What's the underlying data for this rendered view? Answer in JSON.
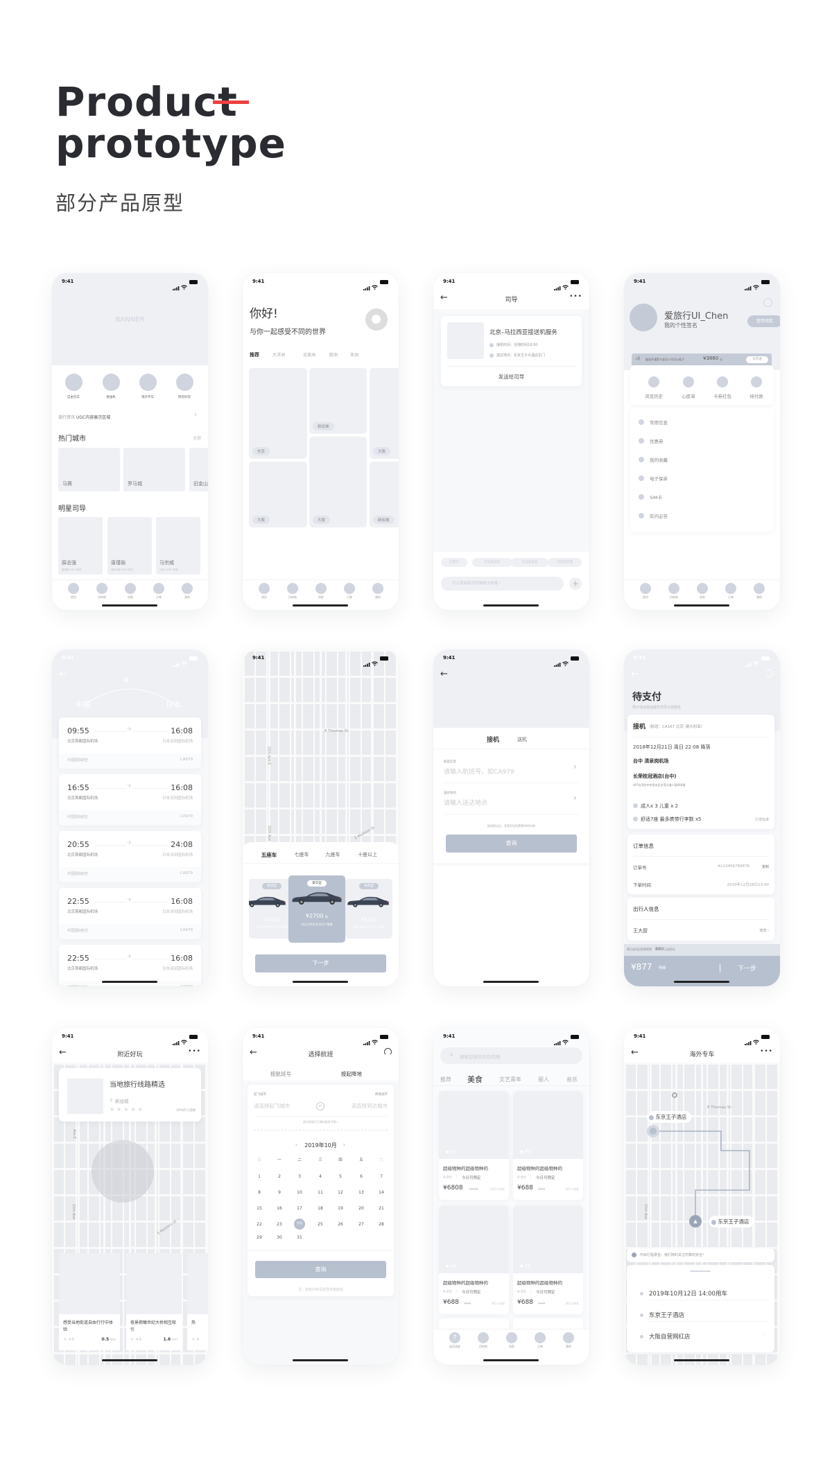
{
  "header": {
    "title_line1": "Product",
    "title_line2": "prototype",
    "subtitle": "部分产品原型",
    "accent_color": "#ee4040"
  },
  "colors": {
    "placeholder": "#eef0f4",
    "accent": "#b7c0cf",
    "dot": "#cfd4de"
  },
  "status_time": "9:41",
  "tabbar": [
    "首页",
    "目的地",
    "消息",
    "订单",
    "我的"
  ],
  "screens": {
    "home": {
      "banner": "BANNER",
      "shortcuts": [
        "自由包车",
        "接送机",
        "境外专车",
        "附近好玩"
      ],
      "news_label": "旅行资讯",
      "news_text": "UGC内容展示区域",
      "hot_title": "热门城市",
      "hot_more": "全部",
      "cities": [
        "马赛",
        "罗马城",
        "旧金山"
      ],
      "guides_title": "明星司导",
      "guides": [
        {
          "name": "薛志强",
          "meta": "新加坡·100+好评"
        },
        {
          "name": "唐瑾瑜",
          "meta": "澳大利亚·900+好评"
        },
        {
          "name": "马宗威",
          "meta": "日本·1200+好评"
        }
      ]
    },
    "discover": {
      "greeting": "你好!",
      "slogan": "与你一起感受不同的世界",
      "tabs": [
        "推荐",
        "大洋洲",
        "北美洲",
        "欧洲",
        "亚洲"
      ],
      "tiles": [
        "东京",
        "新加坡",
        "大阪",
        "大阪",
        "大阪",
        "新加坡"
      ]
    },
    "chat": {
      "title": "司导",
      "card_title": "北京–马拉西亚接送机服务",
      "lines": [
        "接机时间：当地时间18:00",
        "送达地点：东京王子大酒店东门"
      ],
      "send": "发送给司导",
      "chips": [
        "问景点",
        "问当地美食",
        "问当地美食",
        "问当地交通"
      ],
      "input_placeholder": "可以提前和司导聊聊当地哦~"
    },
    "profile": {
      "name": "爱旅行UI_Chen",
      "signature": "我的个性签名",
      "checkin": "签到领奖",
      "promo_text": "据说开通黑卡会员人均可以省下",
      "promo_amount": "¥3860",
      "promo_unit": "元",
      "promo_btn": "去开通",
      "quick": [
        "浏览历史",
        "心愿单",
        "卡券红包",
        "待付款"
      ],
      "menu": [
        "常用信息",
        "优惠券",
        "我的收藏",
        "电子保单",
        "SIM卡",
        "有问必答"
      ]
    },
    "flights": {
      "from": "中国",
      "to": "日本",
      "list": [
        {
          "dep": "09:55",
          "arr": "16:08",
          "from_airport": "北京首都国际机场",
          "to_airport": "日本羽田国际机场",
          "airline": "中国国际航空",
          "code": "CA979"
        },
        {
          "dep": "16:55",
          "arr": "16:08",
          "from_airport": "北京首都国际机场",
          "to_airport": "日本羽田国际机场",
          "airline": "中国国际航空",
          "code": "CA979"
        },
        {
          "dep": "20:55",
          "arr": "24:08",
          "from_airport": "北京首都国际机场",
          "to_airport": "日本羽田国际机场",
          "airline": "中国国际航空",
          "code": "CA979"
        },
        {
          "dep": "22:55",
          "arr": "16:08",
          "from_airport": "北京首都国际机场",
          "to_airport": "日本羽田国际机场",
          "airline": "中国国际航空",
          "code": "CA979"
        },
        {
          "dep": "22:55",
          "arr": "16:08",
          "from_airport": "北京首都国际机场",
          "to_airport": "日本羽田国际机场",
          "airline": "中国国际航空",
          "code": "CA979"
        }
      ]
    },
    "car": {
      "streets": [
        "E Thomas St",
        "15th Ave E",
        "15th Ave",
        "E Madison St"
      ],
      "seat_tabs": [
        "五座车",
        "七座车",
        "九座车",
        "十座以上"
      ],
      "cars": [
        {
          "badge": "舒适型",
          "price": "¥1800",
          "suffix": "",
          "desc": "丰田卡罗拉/东风日产骐威"
        },
        {
          "badge": "豪华型",
          "price": "¥2700",
          "suffix": "起",
          "desc": "丰田卡罗拉/东风日产骐威"
        },
        {
          "badge": "商务型",
          "price": "¥3200",
          "suffix": "",
          "desc": "丰田卡罗拉/东风日产骐威"
        }
      ],
      "next": "下一步"
    },
    "pickup": {
      "tabs": [
        "接机",
        "送机"
      ],
      "fields": [
        {
          "label": "航班信息",
          "placeholder": "请输入航班号，如CA979"
        },
        {
          "label": "送达地点",
          "placeholder": "请输入送达地点"
        }
      ],
      "note": "航班到达后，享受司导免费等待90分钟",
      "submit": "查询"
    },
    "order": {
      "title": "待支付",
      "subtitle": "预计待会挑选最优司导为您服务",
      "service": "接机",
      "flight": "（航班：CA167 北京–澳大利亚）",
      "datetime": "2018年12月21日 周日 22:08 降落",
      "airport": "台中 清泉岗机场",
      "hotel": "长荣桂冠酒店(台中)",
      "address": "407台湾台中市西屯区台湾大道二段666號",
      "passengers": "成人x 3  儿童 x 2",
      "vehicle": "舒适7座  最多携带行李数 x5",
      "luggage": "行李标准",
      "order_info": "订单信息",
      "order_no_label": "订单号",
      "order_no": "A123456789876",
      "copy": "复制",
      "time_label": "下单时间",
      "time": "2019年12月28日13:40",
      "traveler_title": "出行人信息",
      "traveler": "王大厨",
      "edit": "修改 ›",
      "points_pre": "预订成功后您将获得",
      "points": "880",
      "points_post": "元宝积分",
      "price": "¥877",
      "detail": "明细",
      "next": "下一步"
    },
    "nearby": {
      "title": "附近好玩",
      "featured_title": "当地旅行线路精选",
      "location": "新加坡",
      "percent": "30%的人选择",
      "streets": [
        "Ave E",
        "15th Ave",
        "E Madison St"
      ],
      "cards": [
        {
          "title": "感受当地街道自由行行中体验",
          "rating": "4.5",
          "dist": "0.5",
          "unit": "km"
        },
        {
          "title": "夜景俯瞰世纪大桥相互吸引",
          "rating": "4.5",
          "dist": "1.6",
          "unit": "km"
        },
        {
          "title": "热",
          "rating": "4",
          "dist": "",
          "unit": ""
        }
      ]
    },
    "flight_select": {
      "title": "选择航班",
      "tabs": [
        "按航班号",
        "按起降地"
      ],
      "dep_label": "起飞城市",
      "arr_label": "降落城市",
      "dep_ph": "请选择起飞城市",
      "arr_ph": "请选择到达城市",
      "note": "请注意填写正确的航班号哦~",
      "month": "2019年10月",
      "weekdays": [
        "日",
        "一",
        "二",
        "三",
        "四",
        "五",
        "六"
      ],
      "days": [
        "1",
        "2",
        "3",
        "4",
        "5",
        "6",
        "7",
        "8",
        "9",
        "10",
        "11",
        "12",
        "13",
        "14",
        "15",
        "16",
        "17",
        "18",
        "19",
        "20",
        "21",
        "22",
        "23",
        "今天",
        "25",
        "26",
        "27",
        "28",
        "29",
        "30",
        "31"
      ],
      "today": "今天",
      "submit": "查询",
      "footnote": "注：如有中转请选择末趟航班"
    },
    "food": {
      "search_ph": "搜索您想去的目的地",
      "tabs": [
        "推荐",
        "美食",
        "文艺青年",
        "丽人",
        "音乐"
      ],
      "active_tab": "美食",
      "back_top": "返回顶部",
      "cards": [
        {
          "loc": "台北",
          "title": "超级物种的超级物种的",
          "score": "4.9分",
          "avail": "今日可预定",
          "price": "¥6808",
          "orig": "¥9999",
          "count": "2365人体验"
        },
        {
          "loc": "清迈",
          "title": "超级物种的超级物种的",
          "score": "4.9分",
          "avail": "今日可预定",
          "price": "¥688",
          "orig": "¥999",
          "count": "365人体验"
        },
        {
          "loc": "台中",
          "title": "超级物种的超级物种的",
          "score": "4.9分",
          "avail": "今日可预定",
          "price": "¥688",
          "orig": "¥999",
          "count": "365人体验"
        },
        {
          "loc": "东京",
          "title": "超级物种的超级物种的",
          "score": "4.9分",
          "avail": "今日可预定",
          "price": "¥688",
          "orig": "¥999",
          "count": "365人体验"
        }
      ]
    },
    "ride": {
      "title": "海外专车",
      "streets": [
        "E Thomas St",
        "15th Ave"
      ],
      "start_label": "东京王子酒店",
      "end_label": "东京王子酒店",
      "safety": "开启行程录音，我们随时关注司乘的安全!",
      "items": [
        "2019年10月12日 14:00用车",
        "东京王子酒店",
        "大阪自营网红店"
      ]
    }
  }
}
